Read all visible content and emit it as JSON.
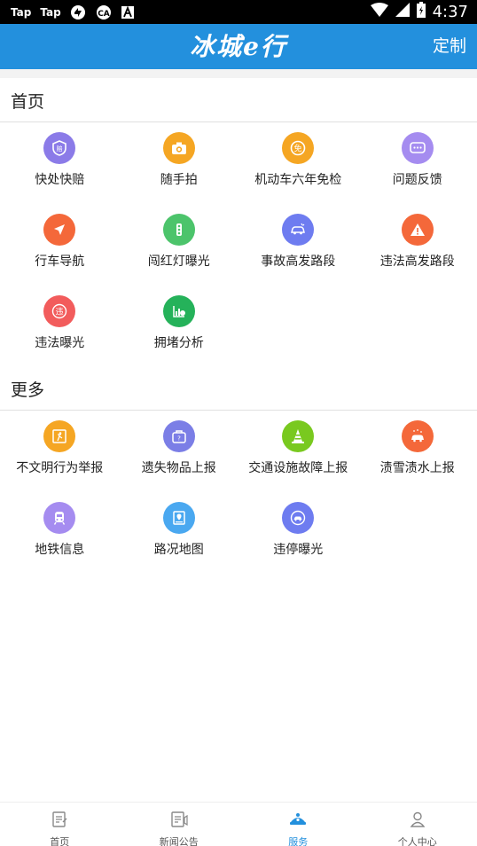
{
  "status_bar": {
    "left_badges": [
      "Tap",
      "Tap"
    ],
    "time": "4:37"
  },
  "header": {
    "title": "冰城e行",
    "customize_label": "定制"
  },
  "sections": [
    {
      "title": "首页",
      "items": [
        {
          "label": "快处快赔",
          "icon": "shield-icon",
          "color": "#8b7be8"
        },
        {
          "label": "随手拍",
          "icon": "camera-icon",
          "color": "#f5a623"
        },
        {
          "label": "机动车六年免检",
          "icon": "exempt-icon",
          "color": "#f5a623"
        },
        {
          "label": "问题反馈",
          "icon": "chat-icon",
          "color": "#a58cf0"
        },
        {
          "label": "行车导航",
          "icon": "navigation-icon",
          "color": "#f4683a"
        },
        {
          "label": "闯红灯曝光",
          "icon": "traffic-light-icon",
          "color": "#4cc46b"
        },
        {
          "label": "事故高发路段",
          "icon": "car-crash-icon",
          "color": "#6e7cf0"
        },
        {
          "label": "违法高发路段",
          "icon": "warning-icon",
          "color": "#f4683a"
        },
        {
          "label": "违法曝光",
          "icon": "violation-icon",
          "color": "#f25c5c"
        },
        {
          "label": "拥堵分析",
          "icon": "chart-icon",
          "color": "#25b25a"
        }
      ]
    },
    {
      "title": "更多",
      "items": [
        {
          "label": "不文明行为举报",
          "icon": "report-icon",
          "color": "#f5a623"
        },
        {
          "label": "遗失物品上报",
          "icon": "lost-item-icon",
          "color": "#7b7ee6"
        },
        {
          "label": "交通设施故障上报",
          "icon": "traffic-cone-icon",
          "color": "#79c91f"
        },
        {
          "label": "渍雪渍水上报",
          "icon": "snow-car-icon",
          "color": "#f4683a"
        },
        {
          "label": "地铁信息",
          "icon": "metro-icon",
          "color": "#a58cf0"
        },
        {
          "label": "路况地图",
          "icon": "map-icon",
          "color": "#4aa8f0"
        },
        {
          "label": "违停曝光",
          "icon": "parking-icon",
          "color": "#6e7cf0"
        }
      ]
    }
  ],
  "bottom_nav": [
    {
      "label": "首页",
      "icon": "home-doc-icon",
      "active": false
    },
    {
      "label": "新闻公告",
      "icon": "news-icon",
      "active": false
    },
    {
      "label": "服务",
      "icon": "service-icon",
      "active": true
    },
    {
      "label": "个人中心",
      "icon": "person-icon",
      "active": false
    }
  ],
  "colors": {
    "primary": "#2390dd",
    "active_nav": "#2390dd"
  }
}
